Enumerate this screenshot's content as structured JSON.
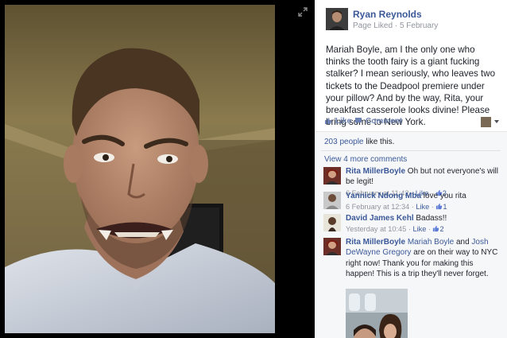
{
  "post": {
    "author": "Ryan Reynolds",
    "meta_liked": "Page Liked",
    "meta_dot": " · ",
    "meta_date": "5 February",
    "text": "Mariah Boyle, am I the only one who thinks the tooth fairy is a giant fucking stalker? I mean seriously, who leaves two tickets to the Deadpool premiere under your pillow? And by the way, Rita, your breakfast casserole looks divine! Please bring some to New York."
  },
  "actions": {
    "like": "Like",
    "comment": "Comment"
  },
  "likes": {
    "count_link": "203 people",
    "suffix": " like this."
  },
  "view_more": "View 4 more comments",
  "comments": [
    {
      "author": "Rita MillerBoyle",
      "text": " Oh but not everyone's will be legit!",
      "time": "6 February at 11:42",
      "like": "Like",
      "count": "2"
    },
    {
      "author": "Yannick Ndong Mba",
      "text": " love you rita",
      "time": "6 February at 12:34",
      "like": "Like",
      "count": "1"
    },
    {
      "author": "David James Kehl",
      "text": " Badass!!",
      "time": "Yesterday at 10:45",
      "like": "Like",
      "count": "2"
    },
    {
      "author": "Rita MillerBoyle",
      "mention1": "Mariah Boyle",
      "and": " and ",
      "mention2": "Josh DeWayne Gregory",
      "text": " are on their way to NYC right now! Thank you for making this happen! This is a trip they'll never forget."
    }
  ],
  "separator": " · ",
  "icons": {
    "expand": "expand-icon",
    "like": "thumbs-up-icon",
    "comment": "speech-bubble-icon",
    "caret": "chevron-down-icon"
  },
  "colors": {
    "link": "#3b5998",
    "action": "#6d84b4",
    "meta": "#90949c",
    "feedback_bg": "#f6f7f9"
  }
}
